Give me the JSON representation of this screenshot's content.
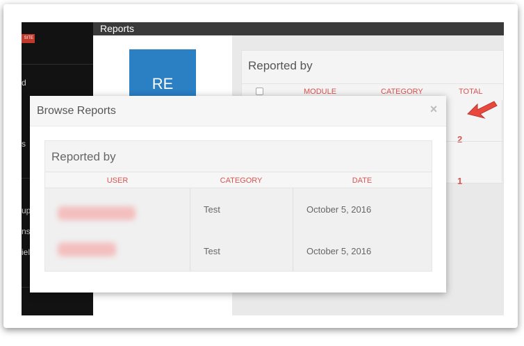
{
  "sidebar": {
    "badge": "SITE",
    "items": [
      "d",
      "s",
      "ups",
      "ns",
      "ield"
    ]
  },
  "header": {
    "title": "Reports"
  },
  "avatar": {
    "initials": "RE"
  },
  "background_card": {
    "title": "Reported by",
    "columns": [
      "MODULE",
      "CATEGORY",
      "TOTAL"
    ],
    "rows": [
      {
        "total": "2"
      },
      {
        "total": "1"
      }
    ]
  },
  "modal": {
    "title": "Browse Reports",
    "close_icon": "×",
    "section_title": "Reported by",
    "columns": [
      "USER",
      "CATEGORY",
      "DATE"
    ],
    "rows": [
      {
        "category": "Test",
        "date": "October 5, 2016"
      },
      {
        "category": "Test",
        "date": "October 5, 2016"
      }
    ]
  },
  "colors": {
    "accent_red": "#d9534f",
    "avatar_blue": "#2b7fc3",
    "sidebar_bg": "#121212",
    "header_bg": "#3a3a3a"
  },
  "icons": {
    "close": "close-icon",
    "checkbox": "checkbox-icon",
    "arrow": "red-arrow-icon"
  }
}
